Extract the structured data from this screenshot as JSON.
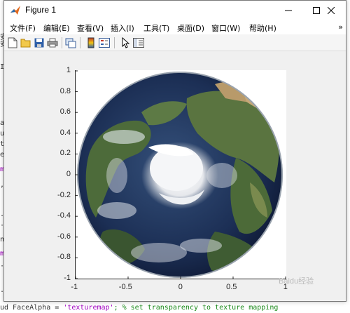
{
  "editor": {
    "left_fragments": [
      "安",
      "安",
      "I",
      "a",
      "u",
      "t",
      "e",
      "m",
      ",",
      ".",
      "·",
      "m",
      "n",
      "·",
      "."
    ],
    "bottom_line_prefix": "ud FaceAlpha = ",
    "bottom_line_string": "'texturemap'",
    "bottom_line_comment": "; % set transparency to texture mapping"
  },
  "window": {
    "title": "Figure 1",
    "controls": {
      "minimize": "minimize-icon",
      "maximize": "maximize-icon",
      "close": "close-icon"
    }
  },
  "menubar": {
    "items": [
      "文件(F)",
      "编辑(E)",
      "查看(V)",
      "插入(I)",
      "工具(T)",
      "桌面(D)",
      "窗口(W)",
      "帮助(H)"
    ],
    "overflow": "»"
  },
  "toolbar": {
    "buttons": [
      {
        "name": "new-figure-icon"
      },
      {
        "name": "open-file-icon"
      },
      {
        "name": "save-icon"
      },
      {
        "name": "print-icon"
      },
      {
        "name": "link-plot-icon"
      },
      {
        "name": "insert-colorbar-icon"
      },
      {
        "name": "insert-legend-icon"
      },
      {
        "name": "edit-plot-arrow-icon"
      },
      {
        "name": "show-plot-tools-icon"
      }
    ]
  },
  "chart_data": {
    "type": "image",
    "description_of_content": "Earth globe viewed from above North Pole",
    "xlim": [
      -1,
      1
    ],
    "ylim": [
      -1,
      1
    ],
    "xticks": [
      "-1",
      "-0.5",
      "0",
      "0.5",
      "1"
    ],
    "yticks": [
      "1",
      "0.8",
      "0.6",
      "0.4",
      "0.2",
      "0",
      "-0.2",
      "-0.4",
      "-0.6",
      "-0.8",
      "-1"
    ],
    "title": "",
    "xlabel": "",
    "ylabel": ""
  },
  "watermark": "Baidu经验"
}
